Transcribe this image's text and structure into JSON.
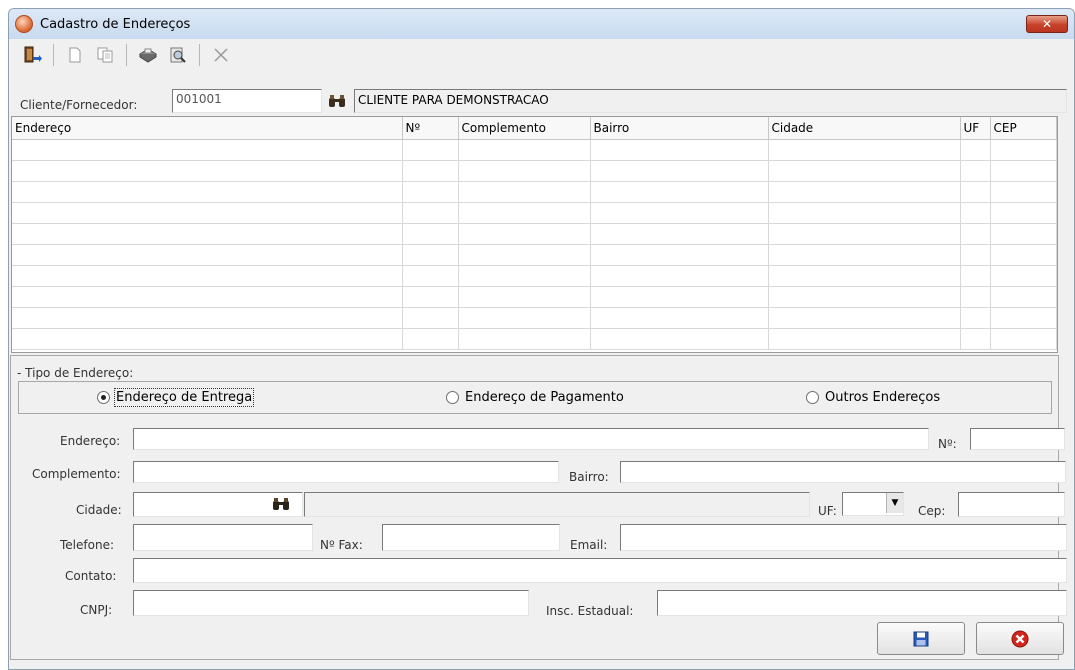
{
  "window": {
    "title": "Cadastro de Endereços",
    "close_label": "✕"
  },
  "toolbar": {
    "buttons": [
      {
        "name": "exit-icon"
      },
      {
        "name": "new-document-icon"
      },
      {
        "name": "copy-icon"
      },
      {
        "name": "print-icon"
      },
      {
        "name": "preview-icon"
      },
      {
        "name": "delete-icon"
      }
    ]
  },
  "client": {
    "label": "Cliente/Fornecedor:",
    "code": "001001",
    "name": "CLIENTE PARA DEMONSTRACAO"
  },
  "grid": {
    "columns": [
      "Endereço",
      "Nº",
      "Complemento",
      "Bairro",
      "Cidade",
      "UF",
      "CEP"
    ],
    "rows": []
  },
  "tipo": {
    "label": "- Tipo de Endereço:",
    "options": [
      "Endereço de Entrega",
      "Endereço de Pagamento",
      "Outros Endereços"
    ],
    "selected": "Endereço de Entrega"
  },
  "form": {
    "endereco_label": "Endereço:",
    "numero_label": "Nº:",
    "complemento_label": "Complemento:",
    "bairro_label": "Bairro:",
    "cidade_label": "Cidade:",
    "uf_label": "UF:",
    "cep_label": "Cep:",
    "telefone_label": "Telefone:",
    "fax_label": "Nº Fax:",
    "email_label": "Email:",
    "contato_label": "Contato:",
    "cnpj_label": "CNPJ:",
    "insc_label": "Insc. Estadual:",
    "endereco": "",
    "numero": "",
    "complemento": "",
    "bairro": "",
    "cidade": "",
    "cidade_nome": "",
    "uf": "",
    "cep": "",
    "telefone": "",
    "fax": "",
    "email": "",
    "contato": "",
    "cnpj": "",
    "insc": ""
  },
  "actions": {
    "save_icon": "save-icon",
    "cancel_icon": "cancel-icon"
  }
}
